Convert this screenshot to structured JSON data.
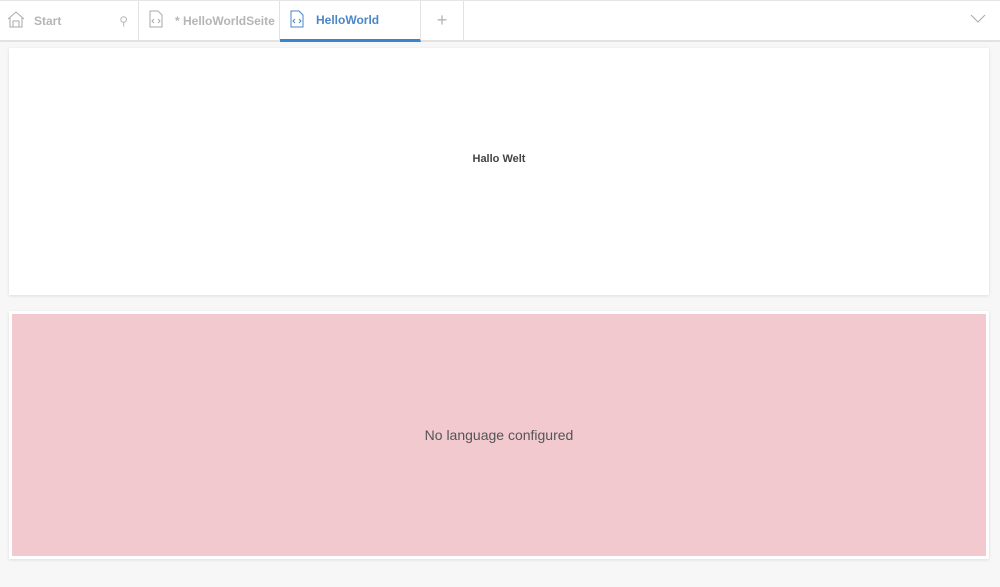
{
  "tabs": [
    {
      "label": "Start",
      "icon": "home-icon"
    },
    {
      "label": "* HelloWorldSeite",
      "icon": "code-file-icon"
    },
    {
      "label": "HelloWorld",
      "icon": "code-file-icon",
      "active": true
    }
  ],
  "add_tab": "+",
  "content": {
    "text": "Hallo Welt"
  },
  "error": {
    "message": "No language configured"
  }
}
